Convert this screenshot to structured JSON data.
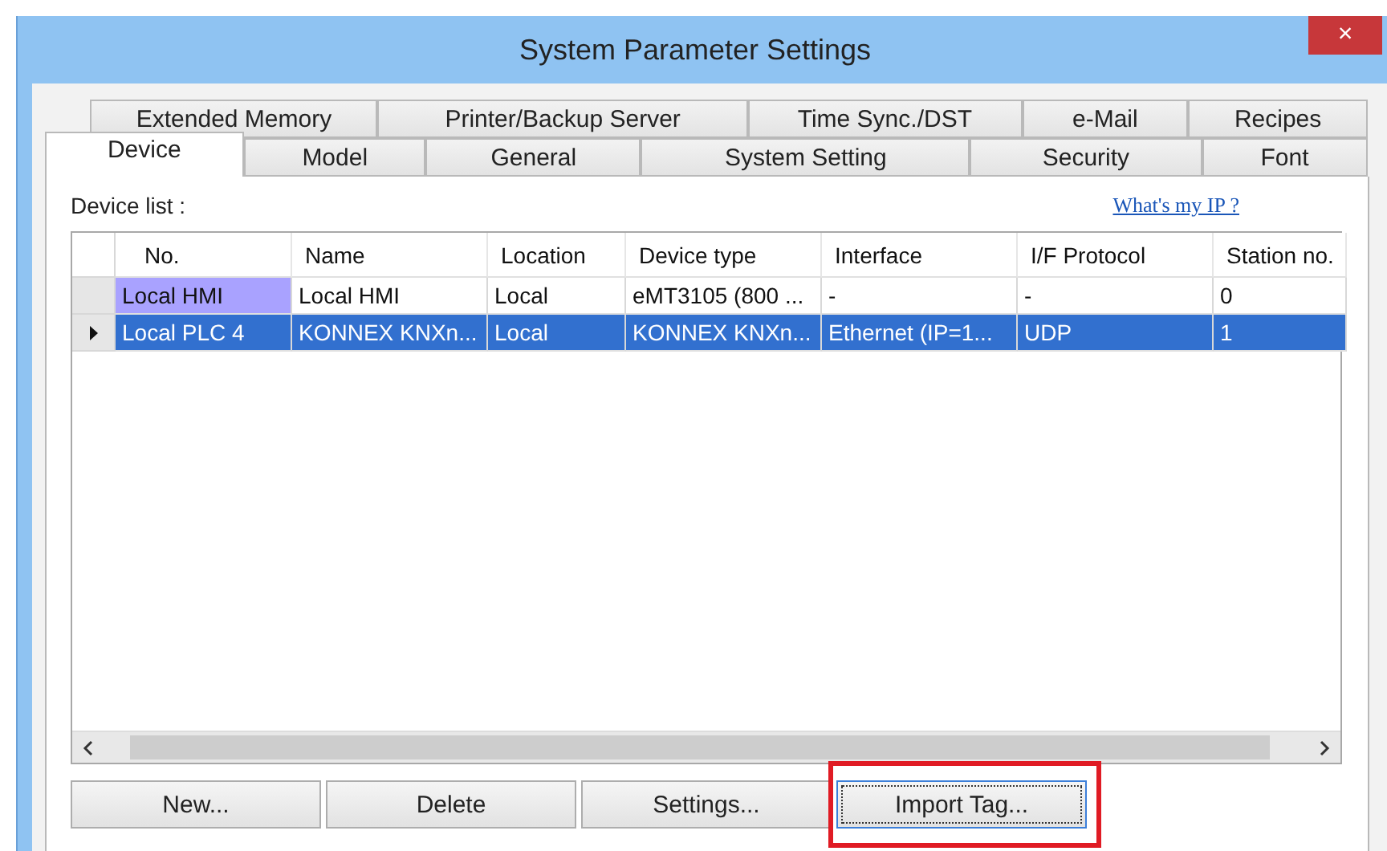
{
  "window": {
    "title": "System Parameter Settings",
    "close": "×"
  },
  "tab_rows": [
    [
      {
        "label": "Extended Memory",
        "selected": false
      },
      {
        "label": "Printer/Backup Server",
        "selected": false
      },
      {
        "label": "Time Sync./DST",
        "selected": false
      },
      {
        "label": "e-Mail",
        "selected": false
      },
      {
        "label": "Recipes",
        "selected": false
      }
    ],
    [
      {
        "label": "Device",
        "selected": true
      },
      {
        "label": "Model",
        "selected": false
      },
      {
        "label": "General",
        "selected": false
      },
      {
        "label": "System Setting",
        "selected": false
      },
      {
        "label": "Security",
        "selected": false
      },
      {
        "label": "Font",
        "selected": false
      }
    ]
  ],
  "device_list": {
    "label": "Device list :",
    "link": "What's my IP ?"
  },
  "table": {
    "columns": [
      "No.",
      "Name",
      "Location",
      "Device type",
      "Interface",
      "I/F Protocol",
      "Station no."
    ],
    "rows": [
      {
        "selected": false,
        "first_cell_highlighted": true,
        "cells": [
          "Local HMI",
          "Local HMI",
          "Local",
          "eMT3105 (800 ...",
          "-",
          "-",
          "0"
        ]
      },
      {
        "selected": true,
        "first_cell_highlighted": false,
        "cells": [
          "Local PLC 4",
          "KONNEX KNXn...",
          "Local",
          "KONNEX KNXn...",
          "Ethernet (IP=1...",
          "UDP",
          "1"
        ]
      }
    ]
  },
  "buttons": [
    {
      "label": "New...",
      "focused": false,
      "highlighted": false
    },
    {
      "label": "Delete",
      "focused": false,
      "highlighted": false
    },
    {
      "label": "Settings...",
      "focused": false,
      "highlighted": false
    },
    {
      "label": "Import Tag...",
      "focused": true,
      "highlighted": true
    }
  ]
}
